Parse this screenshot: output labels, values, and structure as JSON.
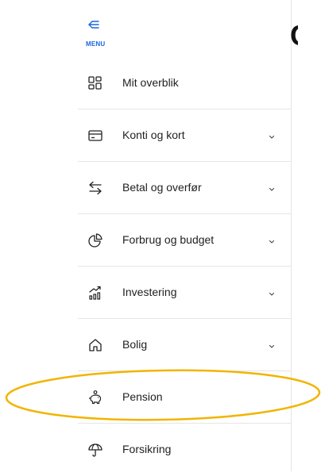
{
  "menu": {
    "toggle_label": "MENU",
    "accent_color": "#1a66e0"
  },
  "page": {
    "partial_title_glyph": "C"
  },
  "nav": {
    "items": [
      {
        "label": "Mit overblik",
        "icon": "dashboard-grid-icon",
        "expandable": false
      },
      {
        "label": "Konti og kort",
        "icon": "credit-card-icon",
        "expandable": true
      },
      {
        "label": "Betal og overfør",
        "icon": "transfer-arrows-icon",
        "expandable": true
      },
      {
        "label": "Forbrug og budget",
        "icon": "pie-chart-icon",
        "expandable": true
      },
      {
        "label": "Investering",
        "icon": "investment-chart-icon",
        "expandable": true
      },
      {
        "label": "Bolig",
        "icon": "house-icon",
        "expandable": true
      },
      {
        "label": "Pension",
        "icon": "piggy-bank-icon",
        "expandable": false
      },
      {
        "label": "Forsikring",
        "icon": "umbrella-icon",
        "expandable": false
      }
    ]
  },
  "annotation": {
    "highlight_color": "#f2b400",
    "highlighted_item": "Pension"
  }
}
